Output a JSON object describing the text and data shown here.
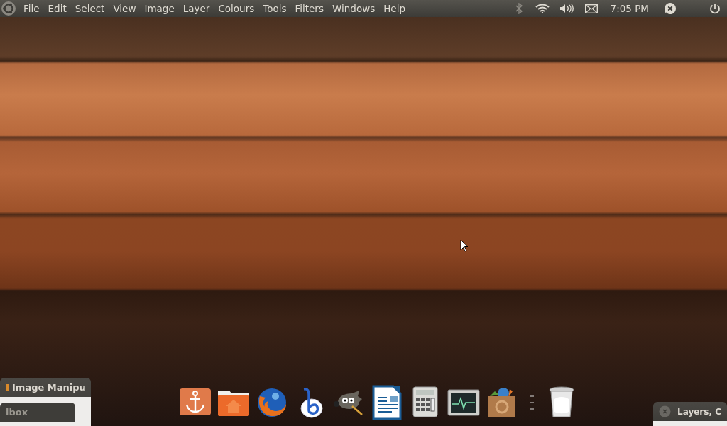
{
  "menu_bar": {
    "items": [
      {
        "label": "File"
      },
      {
        "label": "Edit"
      },
      {
        "label": "Select"
      },
      {
        "label": "View"
      },
      {
        "label": "Image"
      },
      {
        "label": "Layer"
      },
      {
        "label": "Colours"
      },
      {
        "label": "Tools"
      },
      {
        "label": "Filters"
      },
      {
        "label": "Windows"
      },
      {
        "label": "Help"
      }
    ],
    "clock": "7:05 PM"
  },
  "windows": [
    {
      "kind": "main",
      "title": "Image Manipu"
    },
    {
      "kind": "inner",
      "title": "lbox"
    },
    {
      "kind": "right",
      "title": "Layers, C"
    }
  ]
}
